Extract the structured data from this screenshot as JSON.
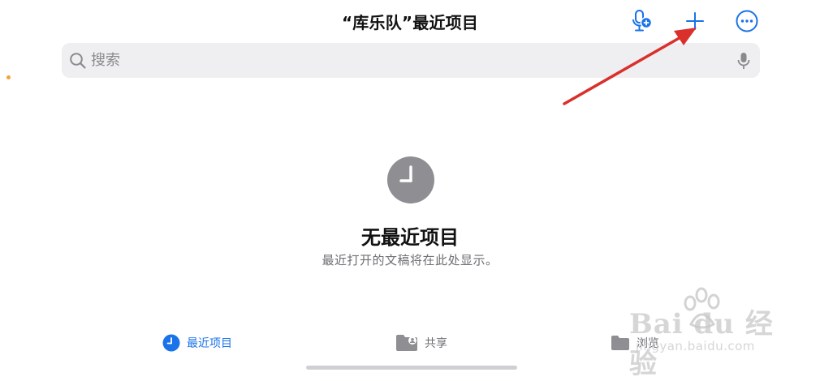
{
  "header": {
    "title": "“库乐队”最近项目"
  },
  "toolbar": {
    "mic_add_icon": "microphone-plus-icon",
    "add_icon": "plus-icon",
    "more_icon": "ellipsis-circle-icon"
  },
  "search": {
    "placeholder": "搜索",
    "value": ""
  },
  "empty_state": {
    "icon": "clock-icon",
    "title": "无最近项目",
    "subtitle": "最近打开的文稿将在此处显示。"
  },
  "tabs": [
    {
      "label": "最近项目",
      "icon": "clock-icon",
      "active": true
    },
    {
      "label": "共享",
      "icon": "shared-folder-icon",
      "active": false
    },
    {
      "label": "浏览",
      "icon": "folder-icon",
      "active": false
    }
  ],
  "colors": {
    "accent": "#1a73e8",
    "annotation": "#d9302c",
    "search_bg": "#efeff1",
    "secondary_text": "#6e6e73"
  },
  "watermark": {
    "brand": "Bai du 经验",
    "url": "jingyan.baidu.com"
  }
}
